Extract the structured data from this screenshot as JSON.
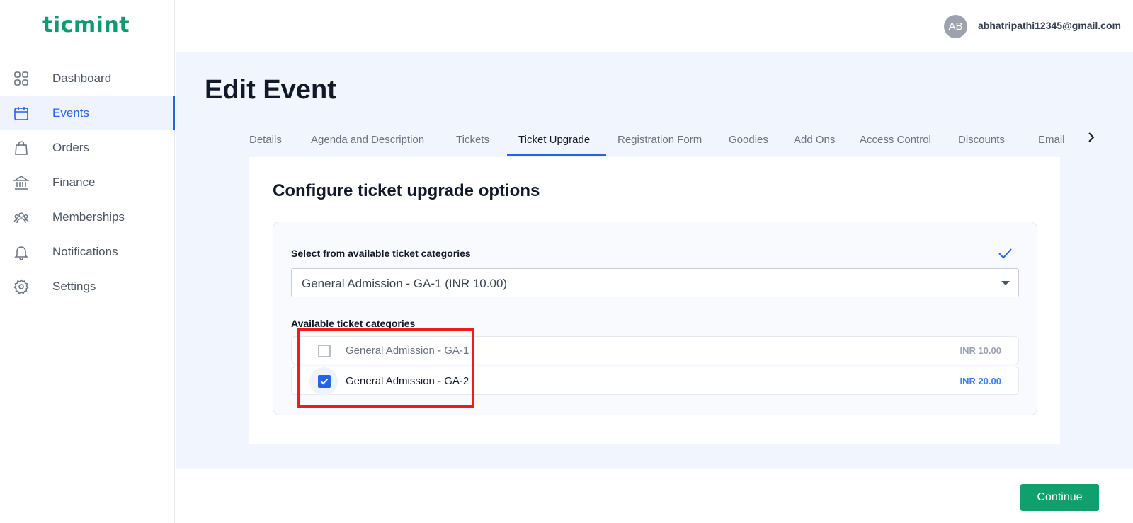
{
  "brand": {
    "logo_text": "ticmint",
    "color": "#0f9b6f"
  },
  "user": {
    "avatar_initials": "AB",
    "email": "abhatripathi12345@gmail.com"
  },
  "sidebar": {
    "items": [
      {
        "label": "Dashboard",
        "icon": "dashboard-grid-icon",
        "active": false
      },
      {
        "label": "Events",
        "icon": "calendar-icon",
        "active": true
      },
      {
        "label": "Orders",
        "icon": "shopping-bag-icon",
        "active": false
      },
      {
        "label": "Finance",
        "icon": "bank-icon",
        "active": false
      },
      {
        "label": "Memberships",
        "icon": "users-icon",
        "active": false
      },
      {
        "label": "Notifications",
        "icon": "bell-icon",
        "active": false
      },
      {
        "label": "Settings",
        "icon": "gear-icon",
        "active": false
      }
    ]
  },
  "page": {
    "title": "Edit Event"
  },
  "tabs": [
    {
      "label": "Details",
      "active": false
    },
    {
      "label": "Agenda and Description",
      "active": false
    },
    {
      "label": "Tickets",
      "active": false
    },
    {
      "label": "Ticket Upgrade",
      "active": true
    },
    {
      "label": "Registration Form",
      "active": false
    },
    {
      "label": "Goodies",
      "active": false
    },
    {
      "label": "Add Ons",
      "active": false
    },
    {
      "label": "Access Control",
      "active": false
    },
    {
      "label": "Discounts",
      "active": false
    },
    {
      "label": "Email",
      "active": false
    }
  ],
  "card": {
    "title": "Configure ticket upgrade options",
    "select_label": "Select from available ticket categories",
    "select_value": "General Admission - GA-1 (INR 10.00)",
    "available_label": "Available ticket categories",
    "categories": [
      {
        "name": "General Admission - GA-1",
        "price": "INR 10.00",
        "checked": false
      },
      {
        "name": "General Admission - GA-2",
        "price": "INR 20.00",
        "checked": true
      }
    ]
  },
  "footer": {
    "continue_label": "Continue"
  },
  "colors": {
    "accent": "#2563eb",
    "primary_button": "#10a06e",
    "highlight": "#ee1c1c"
  }
}
